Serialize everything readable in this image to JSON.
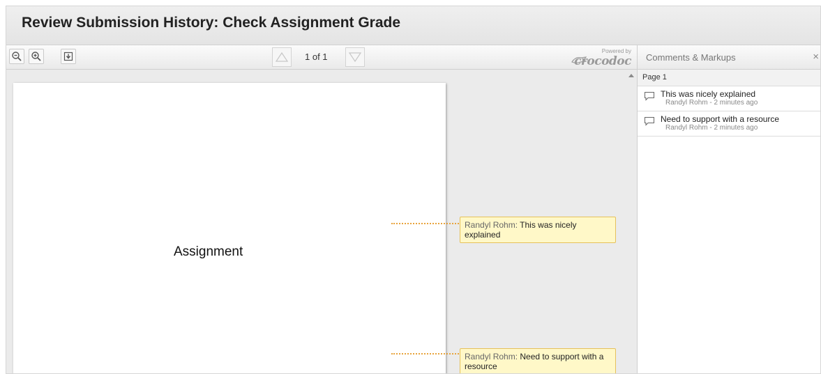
{
  "header": {
    "title": "Review Submission History: Check Assignment Grade"
  },
  "toolbar": {
    "page_counter": "1 of 1",
    "powered_by": "Powered by",
    "brand": "crocodoc"
  },
  "document": {
    "page_text": "Assignment"
  },
  "annotations": [
    {
      "author": "Randyl Rohm:",
      "text": "This was nicely explained"
    },
    {
      "author": "Randyl Rohm:",
      "text": "Need to support with a resource"
    }
  ],
  "sidebar": {
    "title": "Comments & Markups",
    "close": "×",
    "page_label": "Page 1",
    "comments": [
      {
        "text": "This was nicely explained",
        "meta": "Randyl Rohm - 2 minutes ago"
      },
      {
        "text": "Need to support with a resource",
        "meta": "Randyl Rohm - 2 minutes ago"
      }
    ]
  },
  "colors": {
    "note_bg": "#fff8c8",
    "note_border": "#e6c15a",
    "leader": "#e8a33b"
  }
}
